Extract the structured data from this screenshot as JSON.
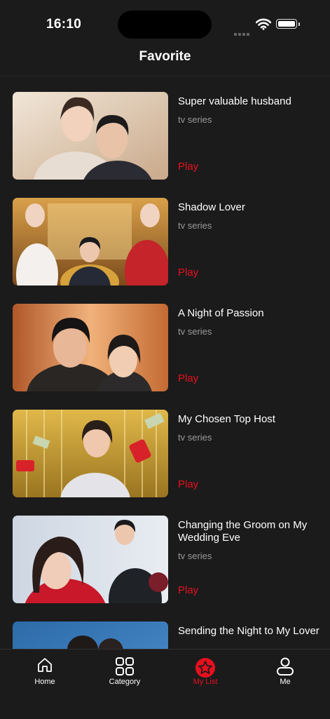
{
  "status": {
    "time": "16:10"
  },
  "header": {
    "title": "Favorite"
  },
  "items": [
    {
      "title": "Super valuable husband",
      "type": "tv series",
      "action": "Play"
    },
    {
      "title": "Shadow Lover",
      "type": "tv series",
      "action": "Play"
    },
    {
      "title": "A Night of Passion",
      "type": "tv series",
      "action": "Play"
    },
    {
      "title": "My Chosen Top Host",
      "type": "tv series",
      "action": "Play"
    },
    {
      "title": "Changing the Groom on My Wedding Eve",
      "type": "tv series",
      "action": "Play"
    },
    {
      "title": "Sending the Night to My Lover",
      "type": "",
      "action": ""
    }
  ],
  "tabs": [
    {
      "label": "Home",
      "icon": "home-icon"
    },
    {
      "label": "Category",
      "icon": "grid-icon"
    },
    {
      "label": "My List",
      "icon": "star-icon",
      "active": true
    },
    {
      "label": "Me",
      "icon": "person-icon"
    }
  ],
  "colors": {
    "accent": "#e8101f",
    "background": "#1b1b1b",
    "secondary_text": "#9a9a9a"
  }
}
